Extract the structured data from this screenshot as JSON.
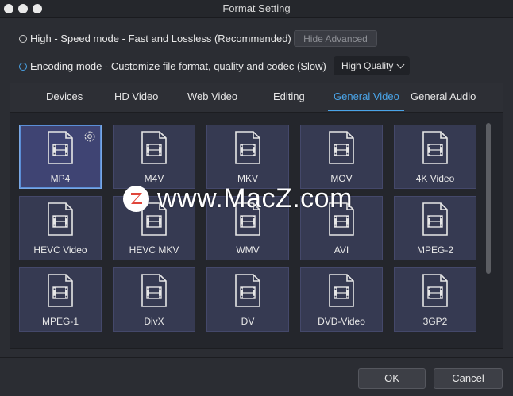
{
  "window": {
    "title": "Format Setting"
  },
  "modes": {
    "high_speed_label": "High - Speed mode - Fast and Lossless (Recommended)",
    "hide_advanced_label": "Hide Advanced",
    "encoding_label": "Encoding mode - Customize file format, quality and codec (Slow)",
    "quality_value": "High Quality",
    "selected": "encoding"
  },
  "tabs": [
    {
      "label": "Devices"
    },
    {
      "label": "HD Video"
    },
    {
      "label": "Web Video"
    },
    {
      "label": "Editing"
    },
    {
      "label": "General Video",
      "active": true
    },
    {
      "label": "General Audio"
    }
  ],
  "formats": [
    {
      "label": "MP4",
      "selected": true
    },
    {
      "label": "M4V"
    },
    {
      "label": "MKV"
    },
    {
      "label": "MOV"
    },
    {
      "label": "4K Video"
    },
    {
      "label": "HEVC Video"
    },
    {
      "label": "HEVC MKV"
    },
    {
      "label": "WMV"
    },
    {
      "label": "AVI"
    },
    {
      "label": "MPEG-2"
    },
    {
      "label": "MPEG-1"
    },
    {
      "label": "DivX"
    },
    {
      "label": "DV"
    },
    {
      "label": "DVD-Video"
    },
    {
      "label": "3GP2"
    }
  ],
  "buttons": {
    "ok": "OK",
    "cancel": "Cancel"
  },
  "watermark": {
    "logo_letter": "Z",
    "text": "www.MacZ.com"
  },
  "colors": {
    "accent": "#4aa4e8",
    "tile": "#363a52",
    "tile_selected": "#3f4473",
    "background": "#2b2d33"
  }
}
